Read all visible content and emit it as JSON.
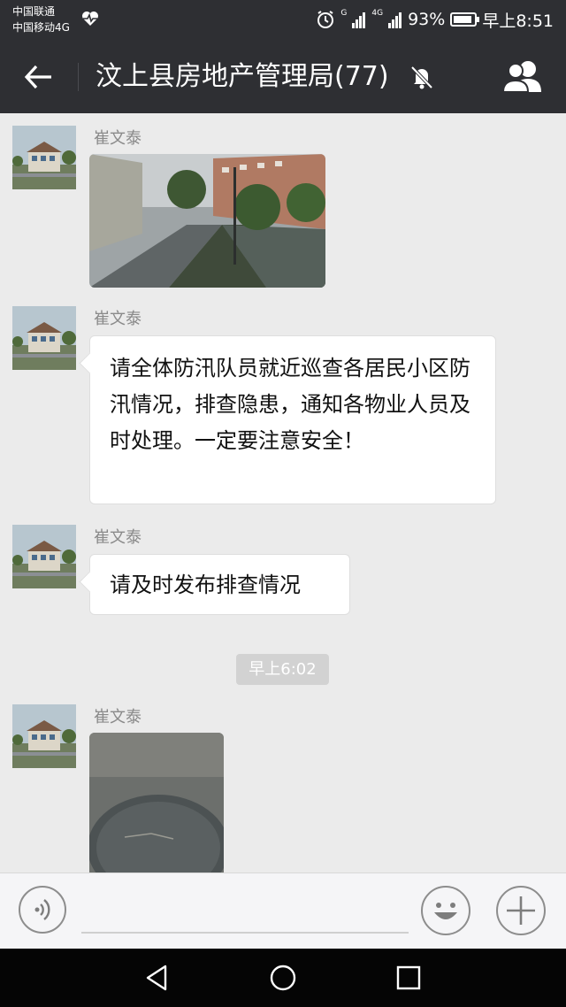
{
  "status_bar": {
    "carrier1": "中国联通",
    "carrier2": "中国移动4G",
    "network_label": "4G",
    "network_label2": "G",
    "battery_level": 0.93,
    "battery_text": "93%",
    "time": "早上8:51"
  },
  "chat": {
    "title": "汶上县房地产管理局(77)",
    "muted": true
  },
  "messages": [
    {
      "sender": "崔文泰",
      "type": "image",
      "image_desc": "rainy-street"
    },
    {
      "sender": "崔文泰",
      "type": "text",
      "text": "请全体防汛队员就近巡查各居民小区防汛情况，排查隐患，通知各物业人员及时处理。一定要注意安全！"
    },
    {
      "sender": "崔文泰",
      "type": "text",
      "text": "请及时发布排查情况"
    },
    {
      "type": "timestamp",
      "text": "早上6:02"
    },
    {
      "sender": "崔文泰",
      "type": "image",
      "image_desc": "manhole-cover"
    }
  ],
  "icons": {
    "back": "arrow-left-icon",
    "mute": "bell-off-icon",
    "members": "people-icon",
    "voice": "voice-icon",
    "emoji": "smiley-icon",
    "plus": "plus-icon",
    "nav_back": "triangle-back-icon",
    "nav_home": "circle-home-icon",
    "nav_recent": "square-recent-icon"
  },
  "colors": {
    "header_bg": "#2e2f33",
    "chat_bg": "#ebebeb",
    "bubble_bg": "#ffffff",
    "sender_name": "#8a8a8a",
    "timestamp_chip": "#d2d2d2"
  }
}
